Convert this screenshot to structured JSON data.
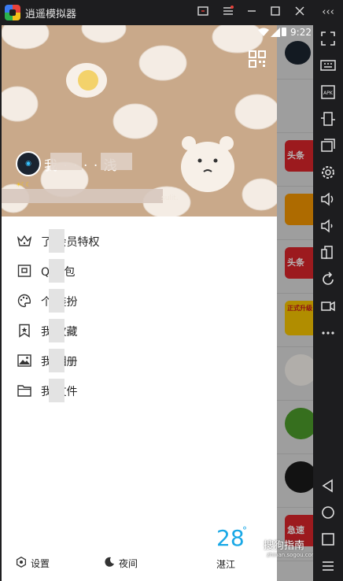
{
  "window": {
    "title": "逍遥模拟器",
    "collapse_label": "‹‹‹"
  },
  "statusbar": {
    "time": "9:22"
  },
  "profile": {
    "nickname": "我 ·   ·  ·  · 浅",
    "signature_tail": "sulit."
  },
  "menu": {
    "items": [
      {
        "label": "了   会员特权",
        "icon": "crown-icon"
      },
      {
        "label": "Q   钱包",
        "icon": "wallet-icon"
      },
      {
        "label": "个   装扮",
        "icon": "palette-icon"
      },
      {
        "label": "我   收藏",
        "icon": "bookmark-star-icon"
      },
      {
        "label": "我   相册",
        "icon": "image-icon"
      },
      {
        "label": "我   文件",
        "icon": "folder-icon"
      }
    ]
  },
  "footer": {
    "settings_label": "设置",
    "night_label": "夜间",
    "temperature": "28",
    "degree": "°",
    "city": "湛江"
  },
  "peek": {
    "items": [
      "头条",
      "头条",
      "正式升级",
      "急速"
    ]
  },
  "watermark": {
    "text": "搜狗指南",
    "url": "zhinan.sogou.com"
  },
  "colors": {
    "accent": "#19a8e6",
    "header_bg": "#c9a98a"
  }
}
